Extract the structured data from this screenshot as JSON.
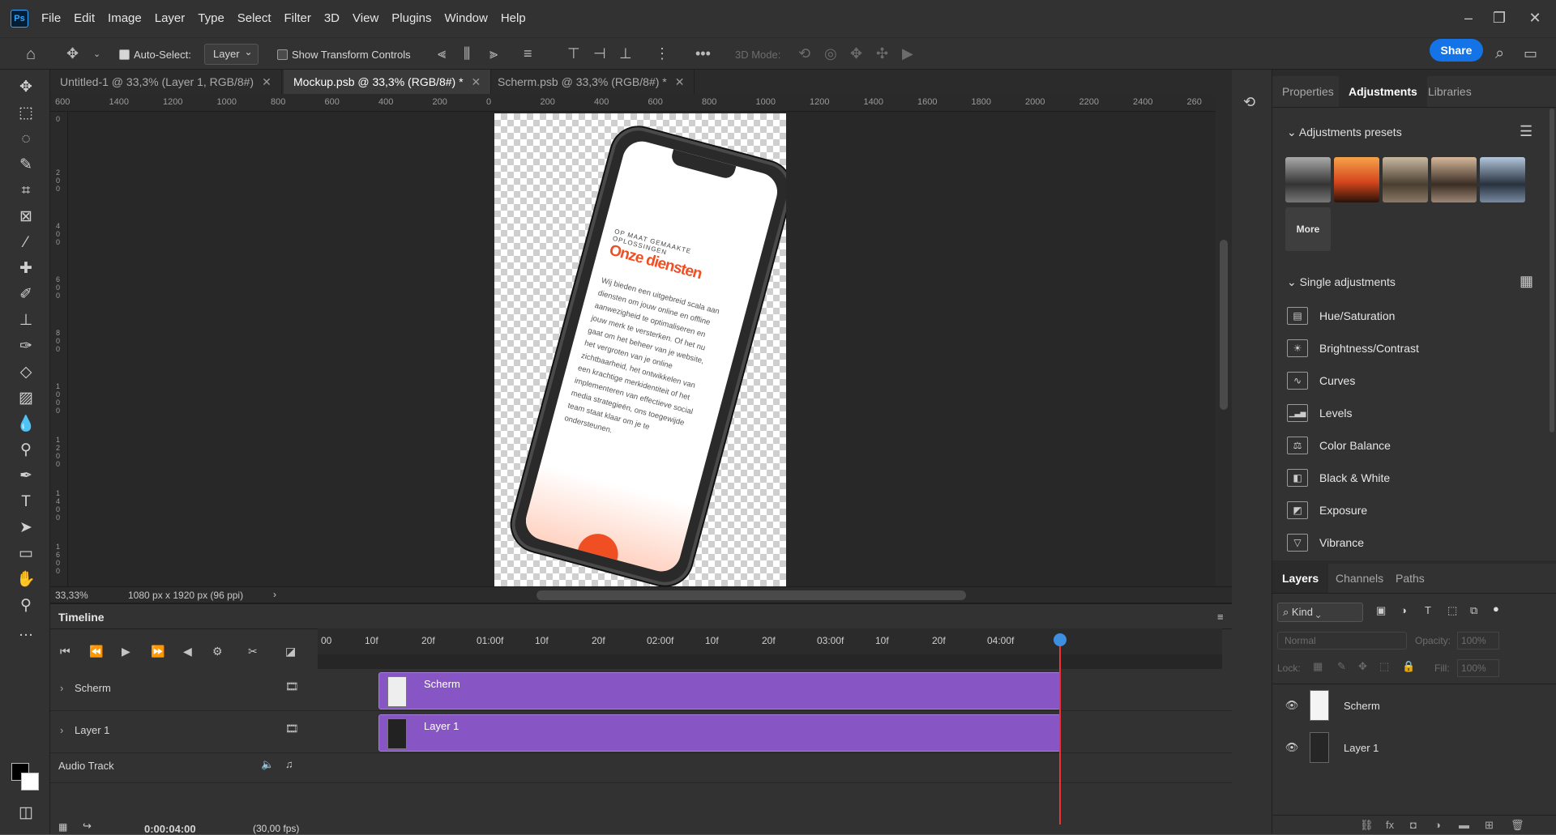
{
  "app": {
    "logo": "Ps"
  },
  "menu": [
    "File",
    "Edit",
    "Image",
    "Layer",
    "Type",
    "Select",
    "Filter",
    "3D",
    "View",
    "Plugins",
    "Window",
    "Help"
  ],
  "options": {
    "auto_select_label": "Auto-Select:",
    "auto_select_value": "Layer",
    "show_transform_label": "Show Transform Controls",
    "mode_3d_label": "3D Mode:",
    "share_label": "Share"
  },
  "doc_tabs": [
    {
      "label": "Untitled-1 @ 33,3% (Layer 1, RGB/8#)",
      "active": false
    },
    {
      "label": "Mockup.psb @ 33,3% (RGB/8#) *",
      "active": true
    },
    {
      "label": "Scherm.psb @ 33,3% (RGB/8#) *",
      "active": false
    }
  ],
  "ruler_h": [
    "600",
    "1400",
    "1200",
    "1000",
    "800",
    "600",
    "400",
    "200",
    "0",
    "200",
    "400",
    "600",
    "800",
    "1000",
    "1200",
    "1400",
    "1600",
    "1800",
    "2000",
    "2200",
    "2400",
    "260"
  ],
  "ruler_v": [
    "0",
    "2 0 0",
    "4 0 0",
    "6 0 0",
    "8 0 0",
    "1 0 0 0",
    "1 2 0 0",
    "1 4 0 0",
    "1 6 0 0"
  ],
  "status": {
    "zoom": "33,33%",
    "doc_size": "1080 px x 1920 px (96 ppi)"
  },
  "phone_screen": {
    "kicker": "OP MAAT GEMAAKTE OPLOSSINGEN",
    "title": "Onze diensten",
    "body": "Wij bieden een uitgebreid scala aan diensten om jouw online en offline aanwezigheid te optimaliseren en jouw merk te versterken. Of het nu gaat om het beheer van je website, het vergroten van je online zichtbaarheid, het ontwikkelen van een krachtige merkidentiteit of het implementeren van effectieve social media strategieën, ons toegewijde team staat klaar om je te ondersteunen."
  },
  "timeline": {
    "title": "Timeline",
    "ruler": [
      "00",
      "10f",
      "20f",
      "01:00f",
      "10f",
      "20f",
      "02:00f",
      "10f",
      "20f",
      "03:00f",
      "10f",
      "20f",
      "04:00f"
    ],
    "tracks": [
      {
        "name": "Scherm",
        "clip": "Scherm"
      },
      {
        "name": "Layer 1",
        "clip": "Layer 1"
      }
    ],
    "audio_track": "Audio Track",
    "timecode": "0:00:04:00",
    "fps": "(30,00 fps)",
    "playhead_fraction": 1.0
  },
  "panel_tabs": [
    "Properties",
    "Adjustments",
    "Libraries"
  ],
  "adjustments": {
    "presets_title": "Adjustments presets",
    "more_label": "More",
    "single_title": "Single adjustments",
    "items": [
      {
        "label": "Hue/Saturation",
        "icon": "hue-saturation-icon",
        "glyph": "▤"
      },
      {
        "label": "Brightness/Contrast",
        "icon": "brightness-icon",
        "glyph": "☀"
      },
      {
        "label": "Curves",
        "icon": "curves-icon",
        "glyph": "∿"
      },
      {
        "label": "Levels",
        "icon": "levels-icon",
        "glyph": "▁▃▅"
      },
      {
        "label": "Color Balance",
        "icon": "color-balance-icon",
        "glyph": "⚖"
      },
      {
        "label": "Black & White",
        "icon": "black-white-icon",
        "glyph": "◧"
      },
      {
        "label": "Exposure",
        "icon": "exposure-icon",
        "glyph": "◩"
      },
      {
        "label": "Vibrance",
        "icon": "vibrance-icon",
        "glyph": "▽"
      }
    ]
  },
  "layers_panel": {
    "tabs": [
      "Layers",
      "Channels",
      "Paths"
    ],
    "kind_label": "Kind",
    "blend_mode": "Normal",
    "opacity_label": "Opacity:",
    "opacity_value": "100%",
    "lock_label": "Lock:",
    "fill_label": "Fill:",
    "fill_value": "100%",
    "layers": [
      {
        "name": "Scherm"
      },
      {
        "name": "Layer 1"
      }
    ]
  },
  "colors": {
    "accent": "#1473e6",
    "clip": "#8856c4",
    "brand_orange": "#f04e23"
  }
}
